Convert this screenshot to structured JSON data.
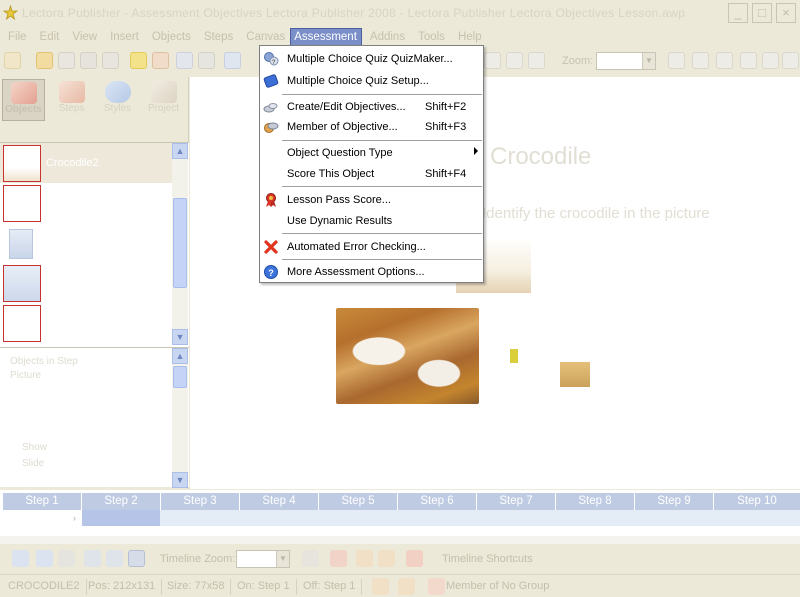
{
  "window": {
    "title": "Lectora Publisher - Assessment Objectives Lectora Publisher 2008 - Lectora Publisher Lectora Objectives Lesson.awp",
    "buttons": [
      "_",
      "□",
      "×"
    ]
  },
  "menubar": {
    "items": [
      "File",
      "Edit",
      "View",
      "Insert",
      "Objects",
      "Steps",
      "Canvas",
      "Assessment",
      "Addins",
      "Tools",
      "Help"
    ]
  },
  "toolbar": {
    "zoom_label": "Zoom:",
    "zoom_value": ""
  },
  "left_panel": {
    "tabs": [
      "Objects",
      "Steps",
      "Styles",
      "Project"
    ],
    "objects": [
      {
        "name": "Crocodile2",
        "selected": true
      },
      {
        "name": ""
      },
      {
        "name": ""
      },
      {
        "name": ""
      },
      {
        "name": ""
      }
    ],
    "properties": {
      "line1": "Objects in Step",
      "line2": "Picture",
      "line3": "Show",
      "line4": "Slide"
    }
  },
  "canvas": {
    "heading": "Crocodile",
    "subheading": "Identify the crocodile in the picture"
  },
  "assessment_menu": {
    "items": [
      {
        "label": "Multiple Choice Quiz QuizMaker...",
        "shortcut": "",
        "icon": "quizmaker-icon"
      },
      {
        "label": "Multiple Choice Quiz Setup...",
        "shortcut": "",
        "icon": "quiz-setup-icon"
      },
      {
        "label": "Create/Edit Objectives...",
        "shortcut": "Shift+F2",
        "icon": "objectives-icon"
      },
      {
        "label": "Member of Objective...",
        "shortcut": "Shift+F3",
        "icon": "member-objective-icon"
      },
      {
        "label": "Object Question Type",
        "shortcut": "",
        "icon": "",
        "submenu": true
      },
      {
        "label": "Score This Object",
        "shortcut": "Shift+F4",
        "icon": ""
      },
      {
        "label": "Lesson Pass Score...",
        "shortcut": "",
        "icon": "pass-score-ribbon-icon"
      },
      {
        "label": "Use Dynamic Results",
        "shortcut": "",
        "icon": ""
      },
      {
        "label": "Automated Error Checking...",
        "shortcut": "",
        "icon": "error-x-icon"
      },
      {
        "label": "More Assessment Options...",
        "shortcut": "",
        "icon": "help-circle-icon"
      }
    ]
  },
  "timeline": {
    "steps": [
      "Step 1",
      "Step 2",
      "Step 3",
      "Step 4",
      "Step 5",
      "Step 6",
      "Step 7",
      "Step 8",
      "Step 9",
      "Step 10"
    ],
    "active_step": "Step 2"
  },
  "bottom_toolbar": {
    "zoom_label": "Timeline Zoom:",
    "zoom_value": "",
    "shortcuts_label": "Timeline Shortcuts"
  },
  "statusbar": {
    "object": "CROCODILE2",
    "pos": "Pos: 212x131",
    "size": "Size: 77x58",
    "on": "On: Step 1",
    "off": "Off: Step 1",
    "group": "Member of No Group"
  },
  "colors": {
    "menu_highlight": "#7a8ec8",
    "timeline_header": "#bfcbe3",
    "selection_border": "#c8332f"
  }
}
